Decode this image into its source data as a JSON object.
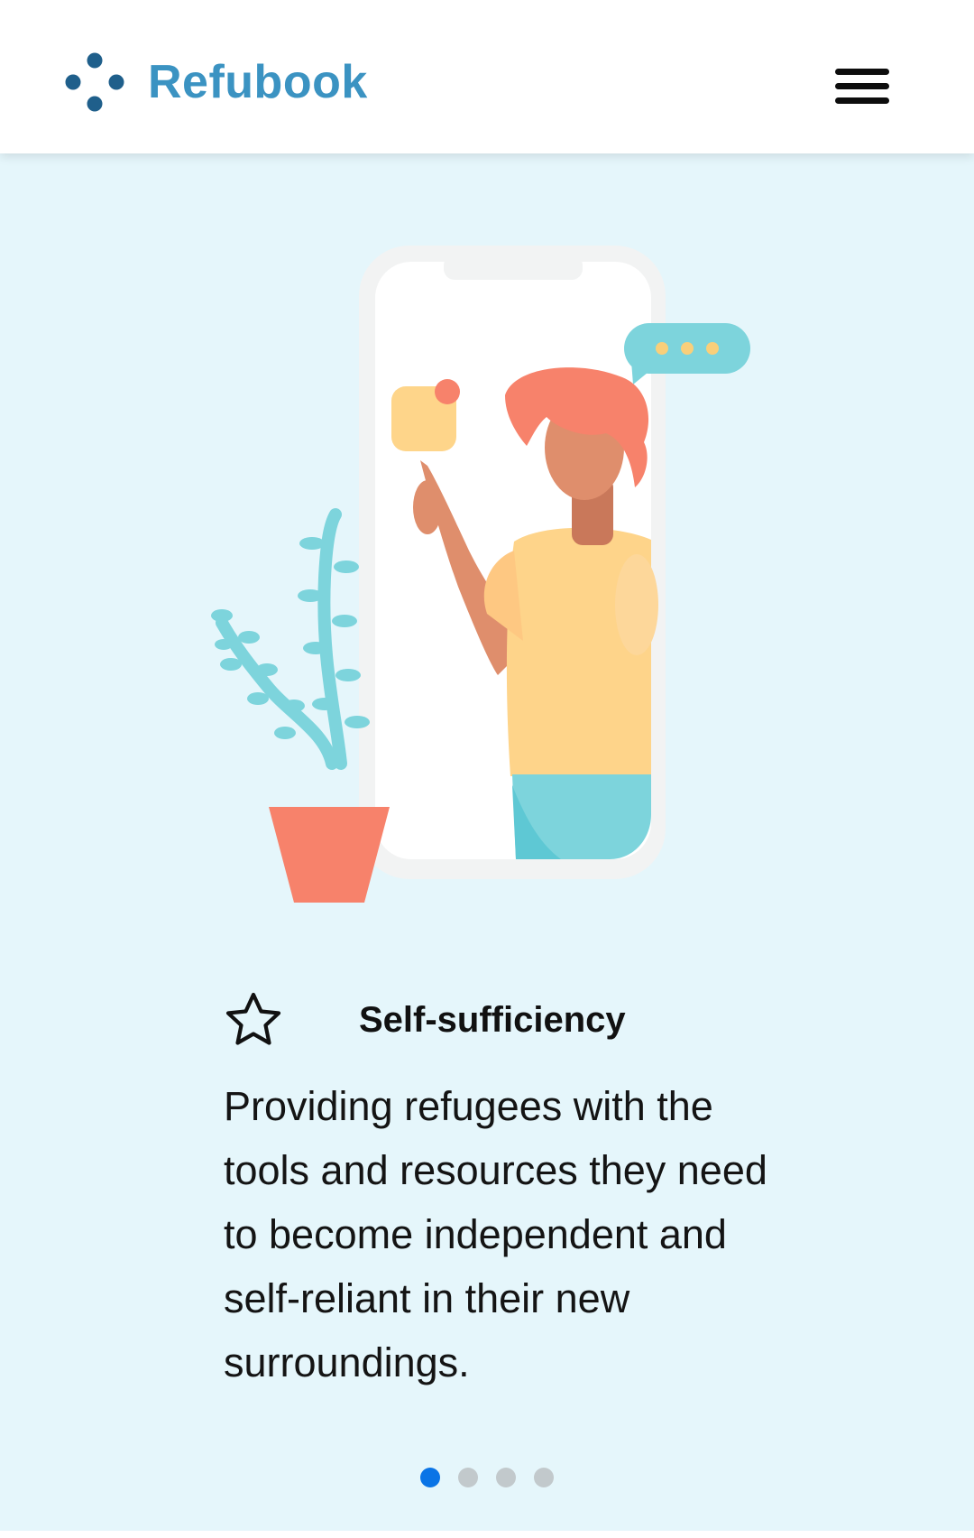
{
  "header": {
    "brand_name": "Refubook"
  },
  "slide": {
    "title": "Self-sufficiency",
    "description": "Providing refugees with the tools and resources they need to become independent and self-reliant in their new surroundings.",
    "icon": "star-icon"
  },
  "carousel": {
    "total_slides": 4,
    "active_index": 0
  },
  "colors": {
    "brand": "#3b93c2",
    "logo_dots": "#1f5f8b",
    "hero_background": "#e5f6fb",
    "active_dot": "#0a74e6",
    "inactive_dot": "#c2c9cc"
  }
}
